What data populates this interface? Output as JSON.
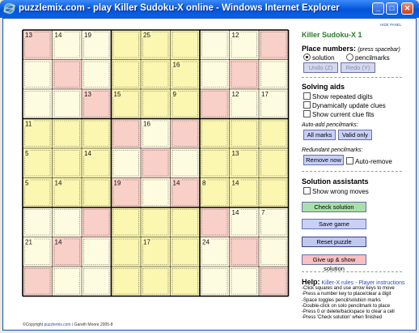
{
  "window": {
    "title": "puzzlemix.com - play Killer Sudoku-X online - Windows Internet Explorer",
    "min_label": "_",
    "max_label": "□",
    "close_label": "✕"
  },
  "hide_panel": "HIDE PANEL",
  "panel": {
    "title": "Killer Sudoku-X 1",
    "place_numbers_label": "Place numbers:",
    "place_numbers_hint": "(press spacebar)",
    "mode_solution": "solution",
    "mode_pencilmarks": "pencilmarks",
    "selected_mode": "solution",
    "undo_label": "Undo (Z)",
    "redo_label": "Redo (Y)",
    "solving_aids_label": "Solving aids",
    "aid_repeated": "Show repeated digits",
    "aid_dynamic": "Dynamically update clues",
    "aid_clue_fits": "Show current clue fits",
    "auto_add_label": "Auto-add pencilmarks:",
    "all_marks_label": "All marks",
    "valid_only_label": "Valid only",
    "redundant_label": "Redundant pencilmarks:",
    "remove_now_label": "Remove now",
    "auto_remove_label": "Auto-remove",
    "assistants_label": "Solution assistants",
    "show_wrong_label": "Show wrong moves",
    "check_solution_label": "Check solution",
    "save_game_label": "Save game",
    "reset_label": "Reset puzzle",
    "give_up_label": "Give up & show solution",
    "help_label": "Help:",
    "help_link": "Killer-X rules - Player instructions",
    "help_lines": [
      "-Click squares and use arrow keys to move",
      "-Press a number key to place/clear a digit",
      "-Space toggles pencil/solution marks",
      "-Double-click on solo pencilmark to place",
      "-Press 0 or delete/backspace to clear a cell",
      "-Press 'Check solution' when finished"
    ]
  },
  "footer": {
    "prefix": "©Copyright",
    "link": "puzzlemix.com",
    "suffix": "/ Gareth Moore 2005-8"
  },
  "colors": {
    "title_bar": "#0a5ee0",
    "cell_cream": "#fefce0",
    "cell_yellow": "#fbf6b0",
    "cell_pink": "#f8d0c8",
    "panel_title_green": "#2d7a2d",
    "check_button": "#a8e0a8",
    "save_button": "#c8d0f8",
    "reset_button": "#c0c8f0",
    "give_up_button": "#f8c0c0"
  },
  "grid": {
    "size": 9,
    "cell_colors": [
      "PWWYYYWWP",
      "WPWYYYWPW",
      "WWPYYYPWW",
      "YYYPWPYYY",
      "YYYWPWYYY",
      "YYYPWPYYY",
      "WWPYYYPWW",
      "WPWYYYWPW",
      "PWWYYYWWP"
    ],
    "clues": [
      {
        "row": 0,
        "col": 0,
        "value": "13"
      },
      {
        "row": 0,
        "col": 1,
        "value": "14"
      },
      {
        "row": 0,
        "col": 2,
        "value": "19"
      },
      {
        "row": 0,
        "col": 4,
        "value": "25"
      },
      {
        "row": 0,
        "col": 7,
        "value": "12"
      },
      {
        "row": 1,
        "col": 5,
        "value": "16"
      },
      {
        "row": 2,
        "col": 2,
        "value": "13"
      },
      {
        "row": 2,
        "col": 3,
        "value": "15"
      },
      {
        "row": 2,
        "col": 5,
        "value": "9"
      },
      {
        "row": 2,
        "col": 7,
        "value": "12"
      },
      {
        "row": 2,
        "col": 8,
        "value": "17"
      },
      {
        "row": 3,
        "col": 0,
        "value": "11"
      },
      {
        "row": 3,
        "col": 4,
        "value": "16"
      },
      {
        "row": 4,
        "col": 0,
        "value": "5"
      },
      {
        "row": 4,
        "col": 2,
        "value": "14"
      },
      {
        "row": 4,
        "col": 7,
        "value": "13"
      },
      {
        "row": 5,
        "col": 0,
        "value": "5"
      },
      {
        "row": 5,
        "col": 1,
        "value": "14"
      },
      {
        "row": 5,
        "col": 3,
        "value": "19"
      },
      {
        "row": 5,
        "col": 5,
        "value": "14"
      },
      {
        "row": 5,
        "col": 6,
        "value": "8"
      },
      {
        "row": 5,
        "col": 7,
        "value": "14"
      },
      {
        "row": 6,
        "col": 7,
        "value": "14"
      },
      {
        "row": 6,
        "col": 8,
        "value": "7"
      },
      {
        "row": 7,
        "col": 0,
        "value": "21"
      },
      {
        "row": 7,
        "col": 1,
        "value": "14"
      },
      {
        "row": 7,
        "col": 4,
        "value": "17"
      },
      {
        "row": 7,
        "col": 6,
        "value": "24"
      }
    ]
  }
}
